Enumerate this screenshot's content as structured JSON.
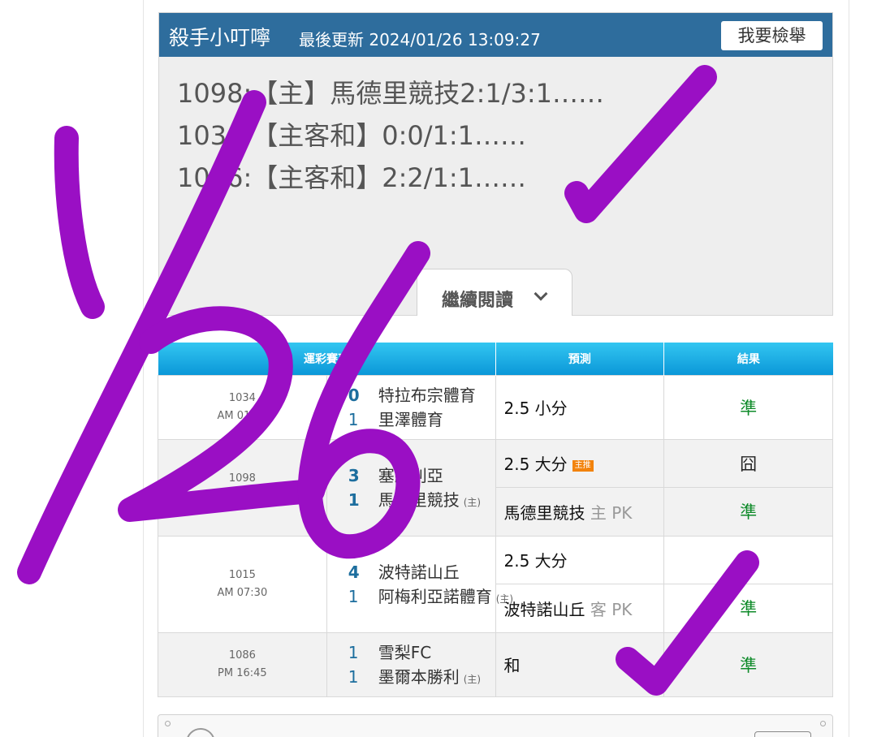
{
  "card": {
    "author": "殺手小叮嚀",
    "updated": "最後更新 2024/01/26 13:09:27",
    "report_button": "我要檢舉",
    "predictions": [
      "1098:【主】馬德里競技2:1/3:1……",
      "1034:【主客和】0:0/1:1……",
      "1086:【主客和】2:2/1:1……"
    ],
    "read_more": "繼續閱讀"
  },
  "table": {
    "headers": [
      "運彩賽事",
      "預測",
      "結果"
    ],
    "matches": [
      {
        "id": "1034",
        "time": "AM 01:00",
        "teams": [
          {
            "score": "0",
            "name": "特拉布宗體育",
            "home": ""
          },
          {
            "score": "1",
            "name": "里澤體育",
            "home": ""
          }
        ],
        "picks": [
          {
            "text": "2.5 小分",
            "side": "",
            "badge": "",
            "result": "準"
          }
        ]
      },
      {
        "id": "1098",
        "time": "AM 04:00",
        "teams": [
          {
            "score": "3",
            "name": "塞維利亞",
            "home": ""
          },
          {
            "score": "1",
            "name": "馬德里競技",
            "home": "(主)"
          }
        ],
        "picks": [
          {
            "text": "2.5 大分",
            "side": "",
            "badge": "主推",
            "result": "囧"
          },
          {
            "text": "馬德里競技",
            "side": "主 PK",
            "badge": "",
            "result": "準"
          }
        ]
      },
      {
        "id": "1015",
        "time": "AM 07:30",
        "teams": [
          {
            "score": "4",
            "name": "波特諾山丘",
            "home": ""
          },
          {
            "score": "1",
            "name": "阿梅利亞諾體育",
            "home": "(主)"
          }
        ],
        "picks": [
          {
            "text": "2.5 大分",
            "side": "",
            "badge": "",
            "result": "準"
          },
          {
            "text": "波特諾山丘",
            "side": "客 PK",
            "badge": "",
            "result": "準"
          }
        ]
      },
      {
        "id": "1086",
        "time": "PM 16:45",
        "teams": [
          {
            "score": "1",
            "name": "雪梨FC",
            "home": ""
          },
          {
            "score": "1",
            "name": "墨爾本勝利",
            "home": "(主)"
          }
        ],
        "picks": [
          {
            "text": "和",
            "side": "",
            "badge": "",
            "result": "準"
          }
        ]
      }
    ]
  },
  "bottom_card": {
    "label": "戰績"
  },
  "overlay": {
    "handwriting": "1/26"
  },
  "colors": {
    "header_blue": "#2e6d9d",
    "table_header_blue": "#13a5e3",
    "hit_green": "#0f8b2a",
    "ink_purple": "#9a0fc4",
    "badge_orange": "#f2830d"
  }
}
